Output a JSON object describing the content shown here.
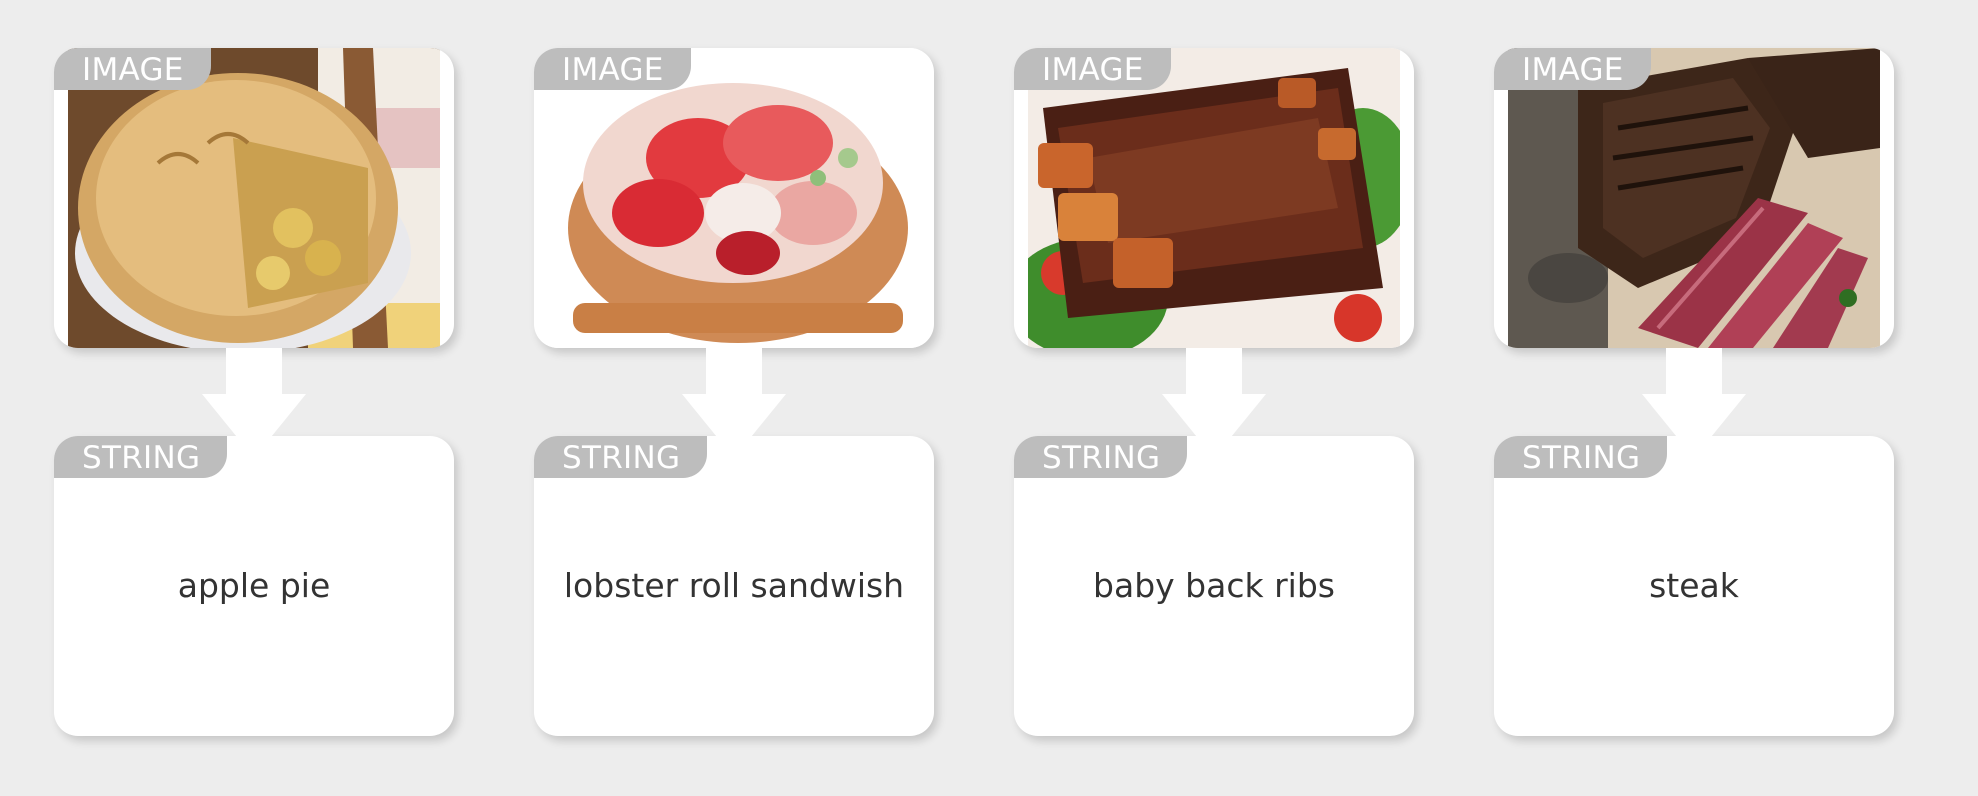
{
  "colors": {
    "background": "#ededed",
    "card": "#ffffff",
    "tag_bg": "#bdbdbd",
    "tag_text": "#ffffff",
    "label_text": "#333333"
  },
  "pairs": [
    {
      "image": {
        "tag": "IMAGE",
        "icon": "apple-pie-photo"
      },
      "arrow_icon": "down-arrow-icon",
      "string": {
        "tag": "STRING",
        "value": "apple pie"
      }
    },
    {
      "image": {
        "tag": "IMAGE",
        "icon": "lobster-roll-photo"
      },
      "arrow_icon": "down-arrow-icon",
      "string": {
        "tag": "STRING",
        "value": "lobster roll sandwish"
      }
    },
    {
      "image": {
        "tag": "IMAGE",
        "icon": "baby-back-ribs-photo"
      },
      "arrow_icon": "down-arrow-icon",
      "string": {
        "tag": "STRING",
        "value": "baby back ribs"
      }
    },
    {
      "image": {
        "tag": "IMAGE",
        "icon": "steak-photo"
      },
      "arrow_icon": "down-arrow-icon",
      "string": {
        "tag": "STRING",
        "value": "steak"
      }
    }
  ]
}
